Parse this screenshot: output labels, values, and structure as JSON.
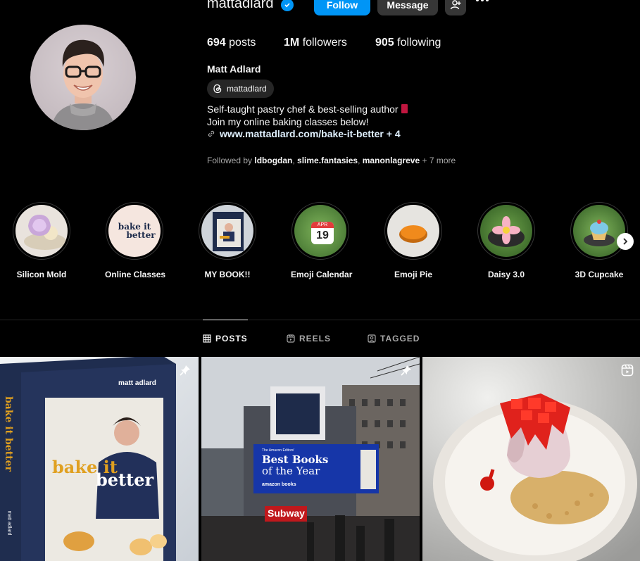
{
  "profile": {
    "username": "mattadlard",
    "follow_label": "Follow",
    "message_label": "Message",
    "posts_count": "694",
    "posts_label": "posts",
    "followers_count": "1M",
    "followers_label": "followers",
    "following_count": "905",
    "following_label": "following",
    "full_name": "Matt Adlard",
    "threads_handle": "mattadlard",
    "bio_line1": "Self-taught pastry chef & best-selling author",
    "bio_line2": "Join my online baking classes below!",
    "link": "www.mattadlard.com/bake-it-better + 4",
    "followed_by_prefix": "Followed by",
    "followed_by_1": "ldbogdan",
    "followed_by_2": "slime.fantasies",
    "followed_by_3": "manonlagreve",
    "followed_by_more": "+ 7 more"
  },
  "highlights": [
    {
      "label": "Silicon Mold"
    },
    {
      "label": "Online Classes",
      "cover_text_1": "bake it",
      "cover_text_2": "better"
    },
    {
      "label": "MY BOOK!!"
    },
    {
      "label": "Emoji Calendar",
      "cal_month": "APR",
      "cal_day": "19"
    },
    {
      "label": "Emoji Pie"
    },
    {
      "label": "Daisy 3.0"
    },
    {
      "label": "3D Cupcake"
    }
  ],
  "tabs": [
    {
      "label": "POSTS",
      "icon": "grid-icon"
    },
    {
      "label": "REELS",
      "icon": "reels-icon"
    },
    {
      "label": "TAGGED",
      "icon": "tagged-icon"
    }
  ],
  "posts": [
    {
      "book_author": "matt adlard",
      "book_title_1": "bake it",
      "book_title_2": "better",
      "spine_title": "bake it better",
      "spine_author": "matt adlard"
    },
    {
      "billboard_small": "The Amazon Editors'",
      "billboard_line1": "Best Books",
      "billboard_line2": "of the Year",
      "billboard_brand": "amazon books",
      "sign": "Subway"
    },
    {}
  ],
  "colors": {
    "accent": "#0095f6",
    "background": "#000000",
    "button_secondary": "#363636",
    "muted_text": "#a8a8a8"
  }
}
